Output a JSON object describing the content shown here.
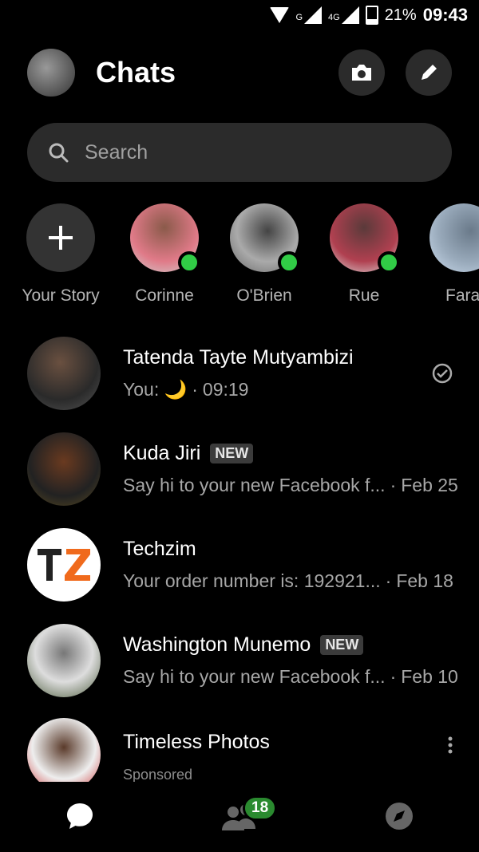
{
  "statusbar": {
    "network_1": "G",
    "network_2": "4G",
    "battery": "21%",
    "time": "09:43"
  },
  "header": {
    "title": "Chats",
    "camera_icon": "camera-icon",
    "edit_icon": "pencil-icon"
  },
  "search": {
    "placeholder": "Search"
  },
  "stories": [
    {
      "label": "Your Story",
      "type": "add"
    },
    {
      "label": "Corinne",
      "online": true
    },
    {
      "label": "O'Brien",
      "online": true
    },
    {
      "label": "Rue",
      "online": true
    },
    {
      "label": "Fara",
      "online": false
    }
  ],
  "chats": [
    {
      "name": "Tatenda Tayte Mutyambizi",
      "preview": "You: 🌙",
      "time": "09:19",
      "status": "read-check-icon"
    },
    {
      "name": "Kuda Jiri",
      "badge": "NEW",
      "preview": "Say hi to your new Facebook f...",
      "time": "Feb 25"
    },
    {
      "name": "Techzim",
      "preview": "Your order number is: 192921...",
      "time": "Feb 18"
    },
    {
      "name": "Washington Munemo",
      "badge": "NEW",
      "preview": "Say hi to your new Facebook f...",
      "time": "Feb 10"
    },
    {
      "name": "Timeless Photos",
      "sponsored": "Sponsored"
    }
  ],
  "bottom_nav": {
    "people_badge": "18"
  },
  "colors": {
    "background": "#000000",
    "online_dot": "#31cc46",
    "badge_green": "#2a8a2f",
    "surface": "#2b2b2b"
  }
}
